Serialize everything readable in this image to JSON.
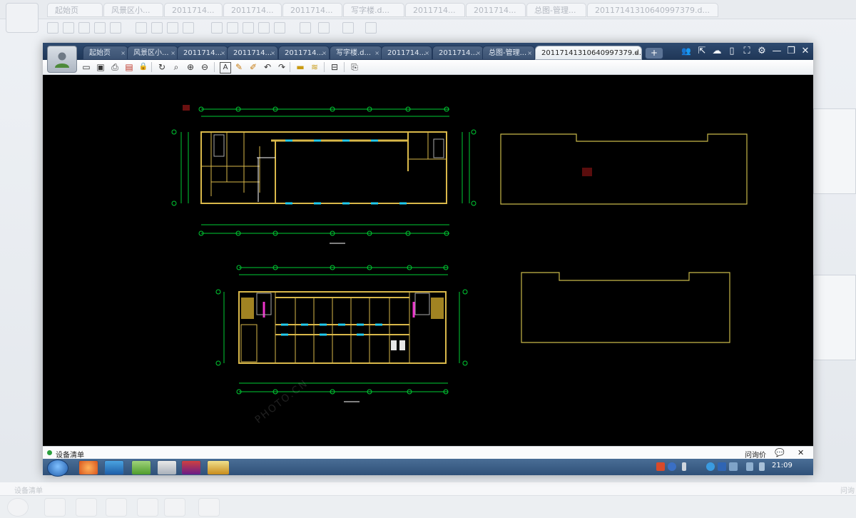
{
  "background": {
    "tabs": [
      "起始页",
      "风景区小...",
      "2011714...",
      "2011714...",
      "2011714...",
      "写字楼.d...",
      "2011714...",
      "2011714...",
      "总图-管理...",
      "20117141310640997379.d..."
    ],
    "status_label": "设备清单",
    "right_status": "问询"
  },
  "app": {
    "tabs": [
      {
        "label": "起始页",
        "active": false
      },
      {
        "label": "风景区小...",
        "active": false
      },
      {
        "label": "2011714...",
        "active": false
      },
      {
        "label": "2011714...",
        "active": false
      },
      {
        "label": "2011714...",
        "active": false
      },
      {
        "label": "写字楼.d...",
        "active": false
      },
      {
        "label": "2011714...",
        "active": false
      },
      {
        "label": "2011714...",
        "active": false
      },
      {
        "label": "总图-管理...",
        "active": false
      },
      {
        "label": "20117141310640997379.d...",
        "active": true
      }
    ],
    "tab_close_glyph": "×",
    "new_tab_glyph": "+",
    "window_controls": {
      "users": "👥",
      "share": "⇱",
      "chat": "☁",
      "phone": "▯",
      "fullscreen": "⛶",
      "settings": "⚙",
      "minimize": "—",
      "restore": "❐",
      "close": "✕"
    },
    "toolbar": {
      "icons": [
        "open-folder-icon",
        "save-icon",
        "print-icon",
        "pdf-export-icon",
        "lock-icon",
        "rotate-icon",
        "zoom-window-icon",
        "zoom-in-icon",
        "zoom-out-icon",
        "text-icon",
        "pencil-icon",
        "marker-icon",
        "undo-icon",
        "redo-icon",
        "layers-icon",
        "hatch-icon",
        "stack-icon",
        "export-icon"
      ],
      "glyphs": [
        "▭",
        "▣",
        "⎙",
        "▤",
        "🔒",
        "↻",
        "⌕",
        "⊕",
        "⊖",
        "A",
        "✎",
        "✐",
        "↶",
        "↷",
        "▬",
        "≋",
        "⊟",
        "⎘"
      ]
    },
    "statusbar": {
      "label": "设备清单",
      "right_label": "问询价",
      "chat_glyph": "💬",
      "close_glyph": "✕"
    },
    "taskbar": {
      "time": "21:09"
    }
  },
  "drawing": {
    "accent_colors": {
      "walls": "#d9b84a",
      "grid": "#00cc33",
      "cyan": "#22ccee",
      "magenta": "#ee33cc",
      "outline": "#c8b84a"
    }
  },
  "watermark": "PHOTO.CN"
}
